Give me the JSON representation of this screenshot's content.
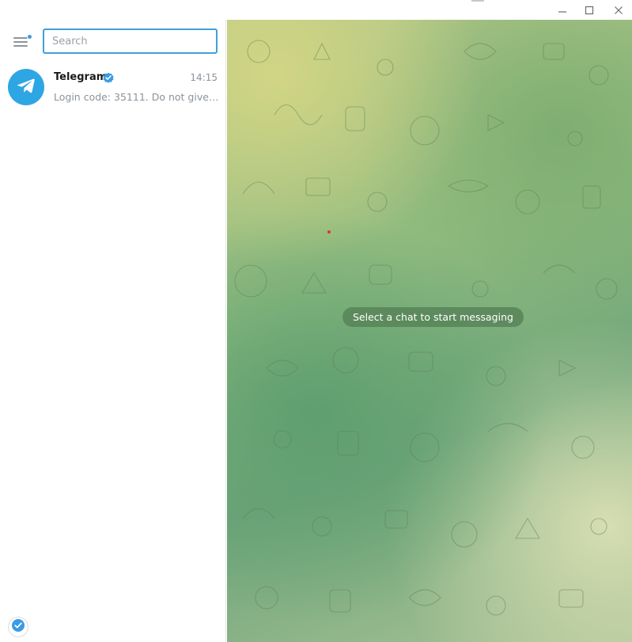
{
  "window": {
    "controls": {
      "minimize_icon": "minimize-icon",
      "maximize_icon": "maximize-icon",
      "close_icon": "close-icon"
    }
  },
  "sidebar": {
    "menu_icon": "hamburger-menu-icon",
    "search": {
      "placeholder": "Search",
      "value": ""
    },
    "chats": [
      {
        "name": "Telegram",
        "verified": true,
        "time": "14:15",
        "preview": "Login code: 35111. Do not give thi…",
        "avatar_icon": "telegram-plane-icon",
        "avatar_color": "#2ea6e3"
      }
    ],
    "bottom_badge_icon": "shield-check-icon"
  },
  "main": {
    "empty_message": "Select a chat to start messaging"
  },
  "colors": {
    "accent": "#3fa0dc",
    "pill_bg": "#548056"
  }
}
